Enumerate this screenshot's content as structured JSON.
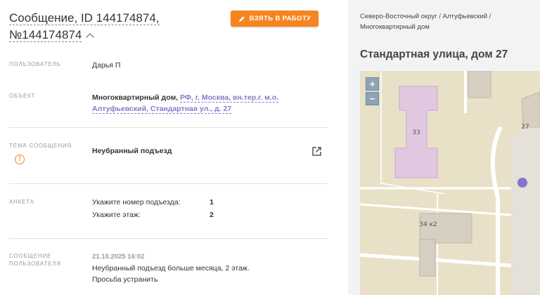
{
  "header": {
    "title_line1": "Сообщение, ID 144174874,",
    "title_line2": "№144174874",
    "take_button": "Взять в работу"
  },
  "fields": {
    "user_label": "Пользователь",
    "user_value": "Дарья П",
    "object_label": "Объект",
    "object_type": "Многоквартирный дом,",
    "object_address": "РФ, г. Москва, вн.тер.г. м.о. Алтуфьевский, Стандартная ул., д. 27",
    "topic_label": "Тема сообщения",
    "topic_value": "Неубранный подъезд",
    "survey_label": "Анкета",
    "survey": [
      {
        "question": "Укажите номер подъезда:",
        "answer": "1"
      },
      {
        "question": "Укажите этаж:",
        "answer": "2"
      }
    ],
    "message_label_1": "Сообщение",
    "message_label_2": "пользователя",
    "message_date": "21.10.2025 16:02",
    "message_text_1": "Неубранный подъезд больше месяца, 2 этаж.",
    "message_text_2": "Просьба устранить"
  },
  "side": {
    "breadcrumb_1": "Северо-Восточный округ / Алтуфьевский /",
    "breadcrumb_2": "Многоквартирный дом",
    "address_title": "Стандартная улица, дом 27"
  },
  "map": {
    "zoom_in": "+",
    "zoom_out": "−",
    "building_33": "33",
    "building_27": "27",
    "building_34k2": "34 к2",
    "colors": {
      "ground": "#e9e0c8",
      "highlight": "#e0c8e0",
      "building": "#d6cfc2",
      "marker": "#8374d0"
    }
  },
  "colors": {
    "accent": "#f6841f",
    "link": "#8a77c8"
  }
}
